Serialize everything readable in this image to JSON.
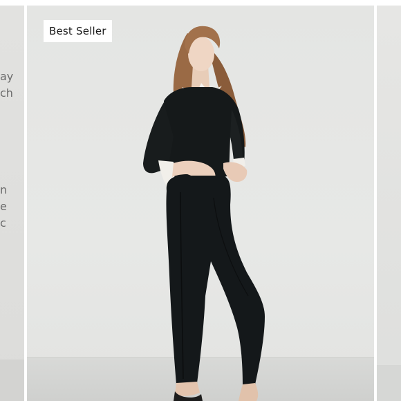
{
  "left_card": {
    "text_fragments": [
      "ay",
      "ch",
      "n",
      "e",
      "c"
    ]
  },
  "product_card": {
    "badge": "Best Seller",
    "image": "model wearing black sweater with white collar and black slim pants"
  },
  "colors": {
    "background": "#e4e5e3",
    "badge_bg": "#ffffff",
    "badge_text": "#1a1a1a",
    "garment": "#15191a"
  }
}
